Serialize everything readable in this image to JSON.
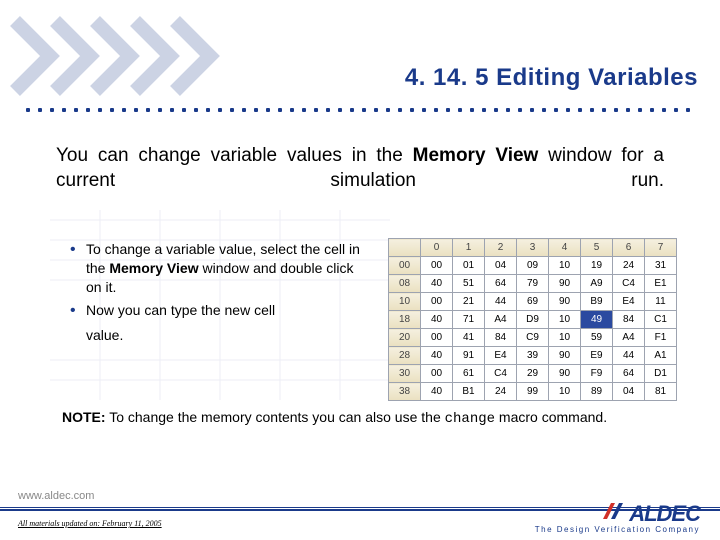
{
  "heading": "4. 14. 5 Editing Variables",
  "intro": {
    "pre": "You can change variable values in the ",
    "bold1": "Memory View",
    "mid": " window for a current simulation run."
  },
  "bullets": {
    "b1_pre": "To change a variable value, select the cell in the ",
    "b1_bold": "Memory View",
    "b1_post": " window and double click on it.",
    "b2": "Now you can type the new cell",
    "tail": "value."
  },
  "note": {
    "label": "NOTE:",
    "text_pre": " To change the memory contents you can also use the ",
    "code": "change",
    "text_post": " macro command."
  },
  "footer": {
    "url": "www.aldec.com",
    "updated": "All materials updated on: February 11, 2005",
    "brand": "ALDEC",
    "tagline": "The Design Verification Company"
  },
  "chart_data": {
    "type": "table",
    "title": "Memory View",
    "col_headers": [
      "0",
      "1",
      "2",
      "3",
      "4",
      "5",
      "6",
      "7"
    ],
    "row_headers": [
      "00",
      "08",
      "10",
      "18",
      "20",
      "28",
      "30",
      "38"
    ],
    "rows": [
      [
        "00",
        "01",
        "04",
        "09",
        "10",
        "19",
        "24",
        "31"
      ],
      [
        "40",
        "51",
        "64",
        "79",
        "90",
        "A9",
        "C4",
        "E1"
      ],
      [
        "00",
        "21",
        "44",
        "69",
        "90",
        "B9",
        "E4",
        "11"
      ],
      [
        "40",
        "71",
        "A4",
        "D9",
        "10",
        "49",
        "84",
        "C1"
      ],
      [
        "00",
        "41",
        "84",
        "C9",
        "10",
        "59",
        "A4",
        "F1"
      ],
      [
        "40",
        "91",
        "E4",
        "39",
        "90",
        "E9",
        "44",
        "A1"
      ],
      [
        "00",
        "61",
        "C4",
        "29",
        "90",
        "F9",
        "64",
        "D1"
      ],
      [
        "40",
        "B1",
        "24",
        "99",
        "10",
        "89",
        "04",
        "81"
      ]
    ],
    "selected": {
      "row": 3,
      "col": 5
    }
  }
}
